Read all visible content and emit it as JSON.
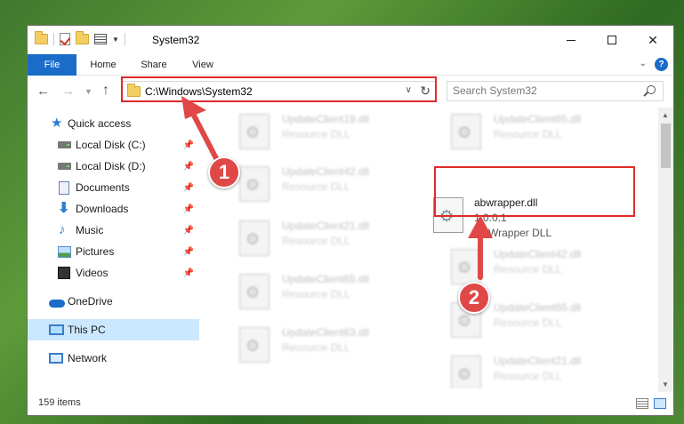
{
  "window": {
    "title": "System32",
    "minimize_symbol": "—",
    "close_symbol": "✕"
  },
  "ribbon": {
    "tabs": [
      {
        "label": "File",
        "active": true
      },
      {
        "label": "Home"
      },
      {
        "label": "Share"
      },
      {
        "label": "View"
      }
    ],
    "help": "?"
  },
  "navigation": {
    "address_path": "C:\\Windows\\System32",
    "search_placeholder": "Search System32"
  },
  "sidebar": {
    "items": [
      {
        "label": "Quick access",
        "icon": "star-icon"
      },
      {
        "label": "Local Disk (C:)",
        "icon": "drive-icon",
        "pinned": true
      },
      {
        "label": "Local Disk (D:)",
        "icon": "drive-icon",
        "pinned": true
      },
      {
        "label": "Documents",
        "icon": "documents-icon",
        "pinned": true
      },
      {
        "label": "Downloads",
        "icon": "download-icon",
        "pinned": true
      },
      {
        "label": "Music",
        "icon": "music-icon",
        "pinned": true
      },
      {
        "label": "Pictures",
        "icon": "pictures-icon",
        "pinned": true
      },
      {
        "label": "Videos",
        "icon": "videos-icon",
        "pinned": true
      },
      {
        "label": "OneDrive",
        "icon": "cloud-icon"
      },
      {
        "label": "This PC",
        "icon": "computer-icon",
        "selected": true
      },
      {
        "label": "Network",
        "icon": "network-icon"
      }
    ]
  },
  "files": {
    "col1": [
      {
        "name": "UpdateClient19.dll",
        "type": "Resource DLL"
      },
      {
        "name": "UpdateClient42.dll",
        "type": "Resource DLL"
      },
      {
        "name": "UpdateClient21.dll",
        "type": "Resource DLL"
      },
      {
        "name": "UpdateClient65.dll",
        "type": "Resource DLL"
      },
      {
        "name": "UpdateClient63.dll",
        "type": "Resource DLL"
      }
    ],
    "col2": [
      {
        "name": "UpdateClient65.dll",
        "type": "Resource DLL"
      },
      {
        "name": "abwrapper.dll",
        "version": "1.0.0.1",
        "type": "ABWrapper DLL",
        "highlighted": true
      },
      {
        "name": "UpdateClient42.dll",
        "type": "Resource DLL"
      },
      {
        "name": "UpdateClient65.dll",
        "type": "Resource DLL"
      },
      {
        "name": "UpdateClient21.dll",
        "type": "Resource DLL"
      }
    ]
  },
  "status": {
    "item_count": "159 items"
  },
  "annotations": {
    "step1": "1",
    "step2": "2",
    "color": "#e04848"
  }
}
